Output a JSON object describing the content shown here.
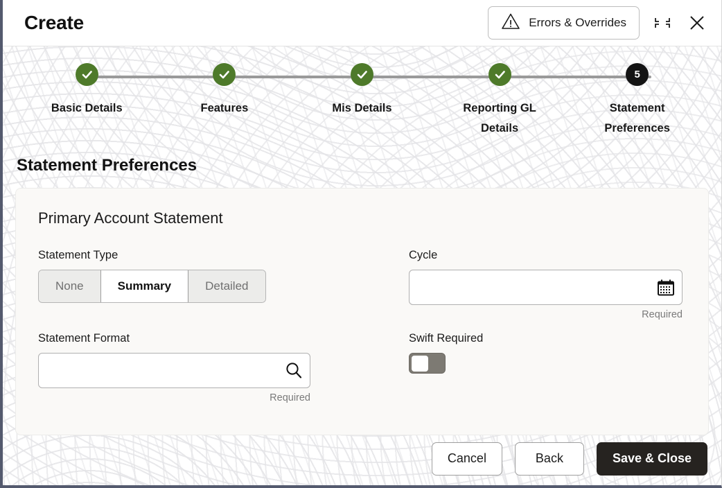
{
  "header": {
    "title": "Create",
    "errors_button_label": "Errors & Overrides",
    "warning_icon": "warning-triangle-icon",
    "minimize_icon": "collapse-icon",
    "close_icon": "close-icon"
  },
  "stepper": {
    "current_step": 5,
    "steps": [
      {
        "label": "Basic Details",
        "state": "done",
        "number": "1"
      },
      {
        "label": "Features",
        "state": "done",
        "number": "2"
      },
      {
        "label": "Mis Details",
        "state": "done",
        "number": "3"
      },
      {
        "label": "Reporting GL Details",
        "state": "done",
        "number": "4"
      },
      {
        "label": "Statement Preferences",
        "state": "current",
        "number": "5"
      }
    ],
    "done_color": "#4e7a2a",
    "current_color": "#141414"
  },
  "main": {
    "section_title": "Statement Preferences",
    "card_title": "Primary Account Statement",
    "fields": {
      "statement_type": {
        "label": "Statement Type",
        "options": [
          "None",
          "Summary",
          "Detailed"
        ],
        "selected": "Summary"
      },
      "cycle": {
        "label": "Cycle",
        "value": "",
        "placeholder": "",
        "helper": "Required",
        "icon": "calendar-icon"
      },
      "statement_format": {
        "label": "Statement Format",
        "value": "",
        "placeholder": "",
        "helper": "Required",
        "icon": "search-icon"
      },
      "swift_required": {
        "label": "Swift Required",
        "checked": false
      }
    }
  },
  "footer": {
    "cancel_label": "Cancel",
    "back_label": "Back",
    "save_label": "Save & Close"
  }
}
